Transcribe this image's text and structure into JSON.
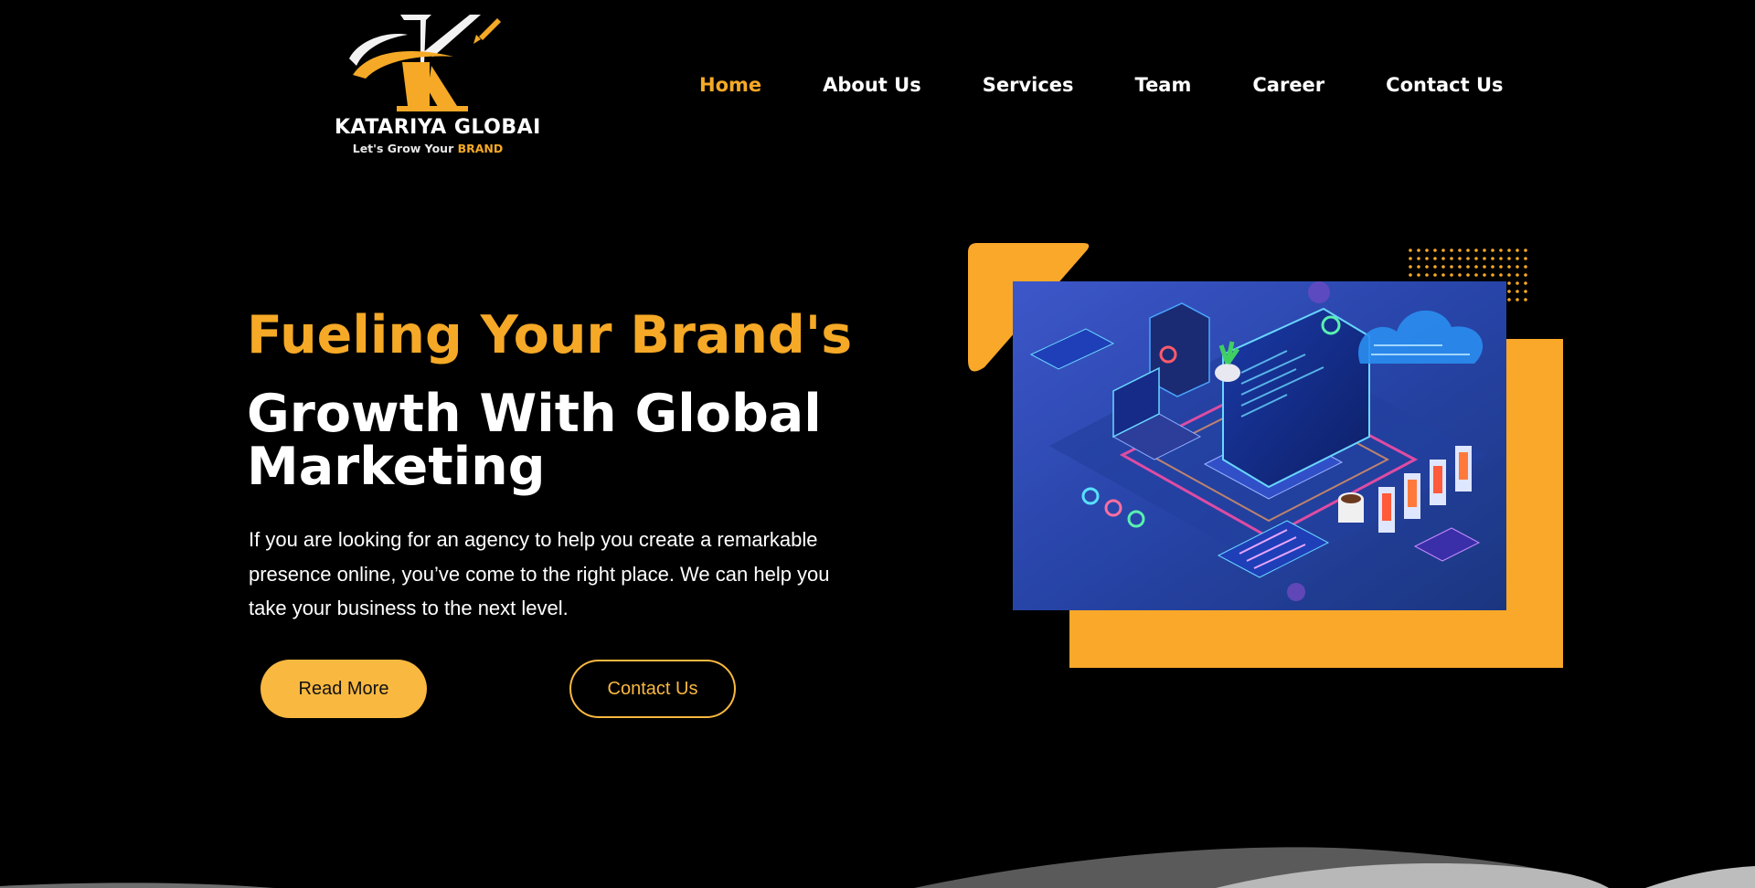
{
  "logo": {
    "letter": "K",
    "name": "KATARIYA GLOBAI",
    "tagline_prefix": "Let's Grow Your ",
    "tagline_highlight": "BRAND"
  },
  "nav": {
    "items": [
      {
        "label": "Home",
        "active": true
      },
      {
        "label": "About Us",
        "active": false
      },
      {
        "label": "Services",
        "active": false
      },
      {
        "label": "Team",
        "active": false
      },
      {
        "label": "Career",
        "active": false
      },
      {
        "label": "Contact Us",
        "active": false
      }
    ]
  },
  "hero": {
    "headline_accent": "Fueling Your Brand's",
    "headline_main": "Growth With Global Marketing",
    "description": "If you are looking for an agency to help you create a remarkable presence online, you’ve come to the right place. We can help you take your business to the next level.",
    "read_more_label": "Read More",
    "contact_label": "Contact Us",
    "image_icon": "isometric-tech-illustration"
  },
  "colors": {
    "background": "#000000",
    "accent": "#f5a926",
    "button_fill": "#f9b840",
    "text": "#ffffff"
  }
}
